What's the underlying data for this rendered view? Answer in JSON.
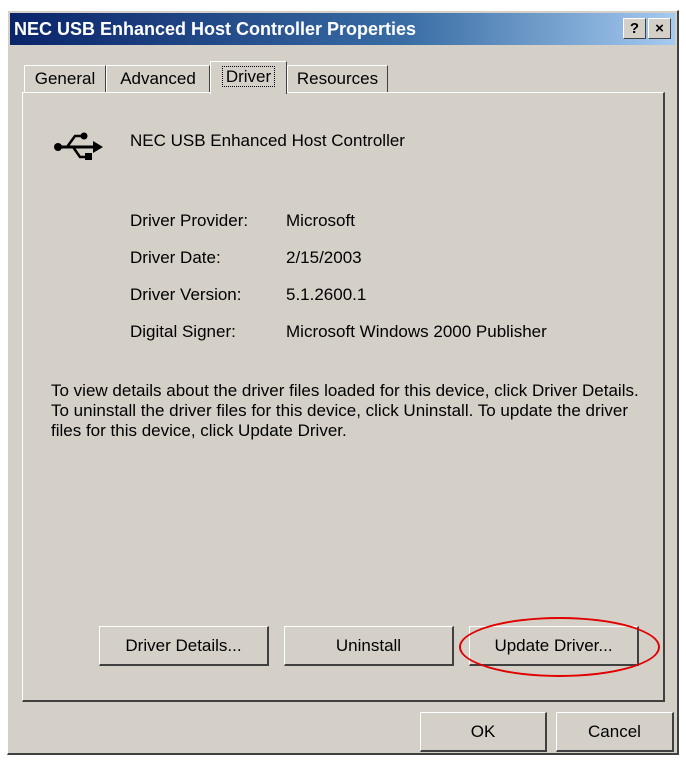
{
  "window": {
    "title": "NEC USB Enhanced Host Controller Properties",
    "help_btn": "?",
    "close_btn": "×"
  },
  "tabs": [
    {
      "label": "General"
    },
    {
      "label": "Advanced"
    },
    {
      "label": "Driver"
    },
    {
      "label": "Resources"
    }
  ],
  "device": {
    "name": "NEC USB Enhanced Host Controller",
    "icon": "usb-icon"
  },
  "info": {
    "provider_label": "Driver Provider:",
    "provider_value": "Microsoft",
    "date_label": "Driver Date:",
    "date_value": "2/15/2003",
    "version_label": "Driver Version:",
    "version_value": "5.1.2600.1",
    "signer_label": "Digital Signer:",
    "signer_value": "Microsoft Windows 2000 Publisher"
  },
  "description": "To view details about the driver files loaded for this device, click Driver Details. To uninstall the driver files for this device, click Uninstall. To update the driver files for this device, click Update Driver.",
  "buttons": {
    "details": "Driver Details...",
    "uninstall": "Uninstall",
    "update": "Update Driver...",
    "ok": "OK",
    "cancel": "Cancel"
  },
  "highlight_color": "#e00000"
}
